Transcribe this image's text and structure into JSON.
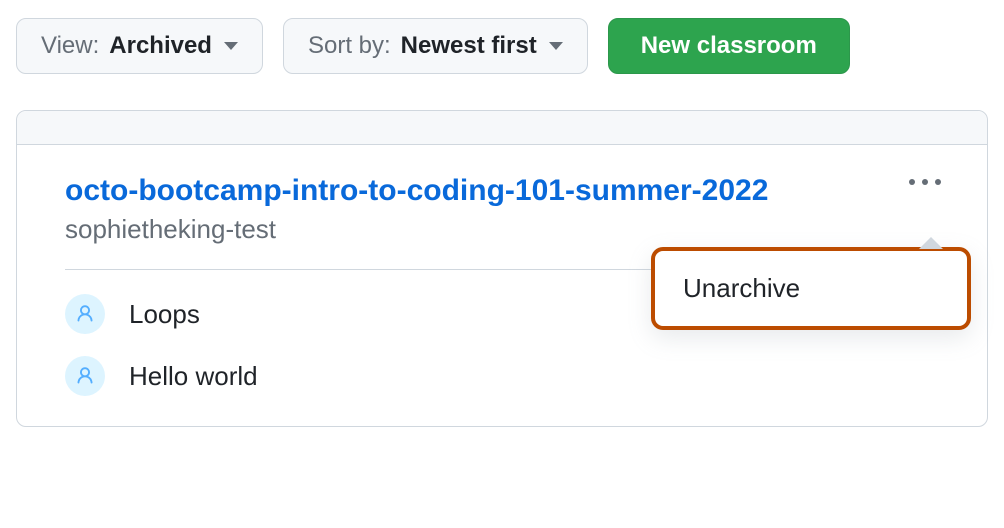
{
  "toolbar": {
    "view": {
      "prefix": "View:",
      "value": "Archived"
    },
    "sort": {
      "prefix": "Sort by:",
      "value": "Newest first"
    },
    "new_classroom_label": "New classroom"
  },
  "classroom": {
    "title": "octo-bootcamp-intro-to-coding-101-summer-2022",
    "org": "sophietheking-test",
    "assignments": [
      {
        "name": "Loops"
      },
      {
        "name": "Hello world"
      }
    ]
  },
  "popover": {
    "items": [
      {
        "label": "Unarchive"
      }
    ]
  }
}
